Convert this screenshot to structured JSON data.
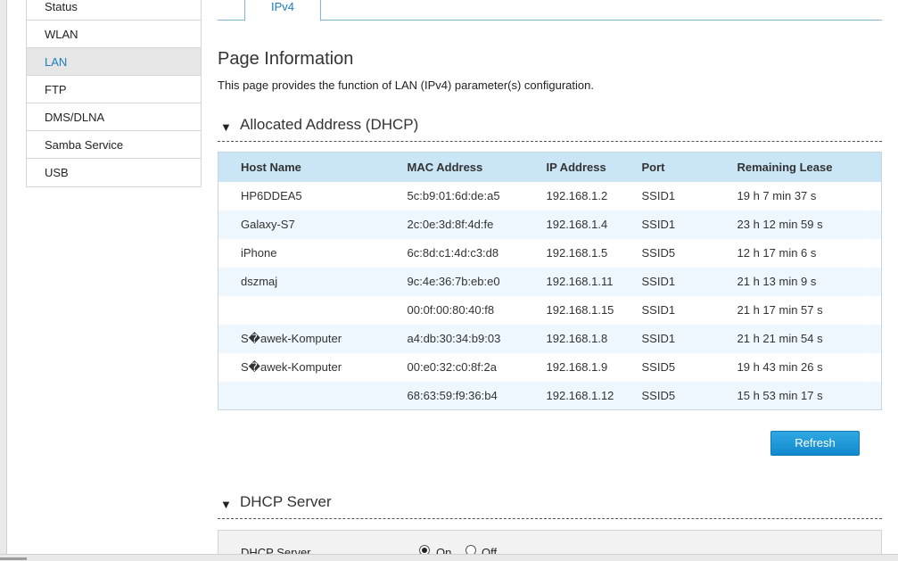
{
  "sidebar": {
    "items": [
      {
        "label": "Status",
        "active": false
      },
      {
        "label": "WLAN",
        "active": false
      },
      {
        "label": "LAN",
        "active": true
      },
      {
        "label": "FTP",
        "active": false
      },
      {
        "label": "DMS/DLNA",
        "active": false
      },
      {
        "label": "Samba Service",
        "active": false
      },
      {
        "label": "USB",
        "active": false
      }
    ]
  },
  "tabs": [
    {
      "label": "IPv4",
      "active": true
    }
  ],
  "page": {
    "title": "Page Information",
    "description": "This page provides the function of LAN (IPv4) parameter(s) configuration."
  },
  "allocated": {
    "section_title": "Allocated Address (DHCP)",
    "columns": [
      "Host Name",
      "MAC Address",
      "IP Address",
      "Port",
      "Remaining Lease"
    ],
    "rows": [
      [
        "HP6DDEA5",
        "5c:b9:01:6d:de:a5",
        "192.168.1.2",
        "SSID1",
        "19 h 7 min 37 s"
      ],
      [
        "Galaxy-S7",
        "2c:0e:3d:8f:4d:fe",
        "192.168.1.4",
        "SSID1",
        "23 h 12 min 59 s"
      ],
      [
        "iPhone",
        "6c:8d:c1:4d:c3:d8",
        "192.168.1.5",
        "SSID5",
        "12 h 17 min 6 s"
      ],
      [
        "dszmaj",
        "9c:4e:36:7b:eb:e0",
        "192.168.1.11",
        "SSID1",
        "21 h 13 min 9 s"
      ],
      [
        "",
        "00:0f:00:80:40:f8",
        "192.168.1.15",
        "SSID1",
        "21 h 17 min 57 s"
      ],
      [
        "S�awek-Komputer",
        "a4:db:30:34:b9:03",
        "192.168.1.8",
        "SSID1",
        "21 h 21 min 54 s"
      ],
      [
        "S�awek-Komputer",
        "00:e0:32:c0:8f:2a",
        "192.168.1.9",
        "SSID5",
        "19 h 43 min 26 s"
      ],
      [
        "",
        "68:63:59:f9:36:b4",
        "192.168.1.12",
        "SSID5",
        "15 h 53 min 17 s"
      ]
    ],
    "refresh_label": "Refresh"
  },
  "dhcp_server": {
    "section_title": "DHCP Server",
    "label": "DHCP Server",
    "on_label": "On",
    "off_label": "Off",
    "selected": "On"
  },
  "colors": {
    "accent": "#1a7fc0",
    "table_header": "#c9e5f6",
    "row_alt": "#eef7fd",
    "button": "#1189cd"
  }
}
